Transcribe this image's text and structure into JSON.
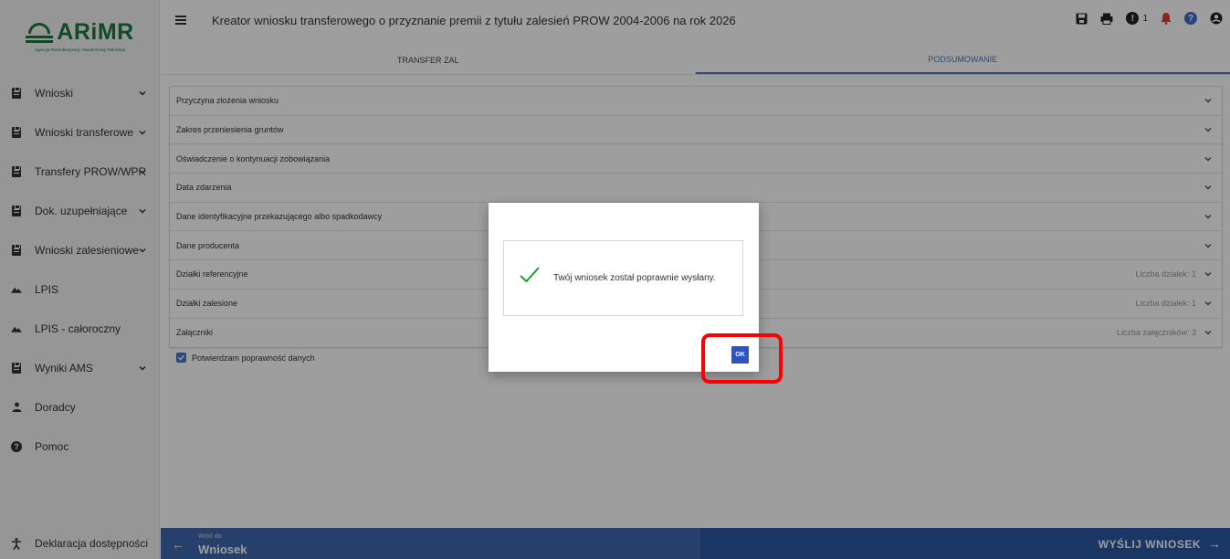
{
  "app": {
    "logo_text": "ARiMR",
    "logo_subtitle": "Agencja Restrukturyzacji i Modernizacji Rolnictwa"
  },
  "header": {
    "title": "Kreator wniosku transferowego o przyznanie premii z tytułu zalesień PROW 2004-2006 na rok 2026",
    "notification_count": "1"
  },
  "sidebar": {
    "items": [
      {
        "label": "Wnioski",
        "icon": "clipboard-icon",
        "expandable": true
      },
      {
        "label": "Wnioski transferowe",
        "icon": "clipboard-icon",
        "expandable": true
      },
      {
        "label": "Transfery PROW/WPR",
        "icon": "clipboard-icon",
        "expandable": true
      },
      {
        "label": "Dok. uzupełniające",
        "icon": "clipboard-icon",
        "expandable": true
      },
      {
        "label": "Wnioski zalesieniowe",
        "icon": "clipboard-icon",
        "expandable": true
      },
      {
        "label": "LPIS",
        "icon": "mountain-icon",
        "expandable": false
      },
      {
        "label": "LPIS - całoroczny",
        "icon": "mountain-icon",
        "expandable": false
      },
      {
        "label": "Wyniki AMS",
        "icon": "clipboard-icon",
        "expandable": true
      },
      {
        "label": "Doradcy",
        "icon": "person-icon",
        "expandable": false
      },
      {
        "label": "Pomoc",
        "icon": "help-icon",
        "expandable": false
      }
    ],
    "accessibility": "Deklaracja dostępności"
  },
  "tabs": [
    {
      "label": "TRANSFER ZAL",
      "active": false
    },
    {
      "label": "PODSUMOWANIE",
      "active": true
    }
  ],
  "sections": [
    {
      "label": "Przyczyna złożenia wniosku",
      "meta": ""
    },
    {
      "label": "Zakres przeniesienia gruntów",
      "meta": ""
    },
    {
      "label": "Oświadczenie o kontynuacji zobowiązania",
      "meta": ""
    },
    {
      "label": "Data zdarzenia",
      "meta": ""
    },
    {
      "label": "Dane identyfikacyjne przekazującego albo spadkodawcy",
      "meta": ""
    },
    {
      "label": "Dane producenta",
      "meta": ""
    },
    {
      "label": "Działki referencyjne",
      "meta": "Liczba działek: 1"
    },
    {
      "label": "Działki zalesione",
      "meta": "Liczba działek: 1"
    },
    {
      "label": "Załączniki",
      "meta": "Liczba załączników: 3"
    }
  ],
  "confirm": {
    "label": "Potwierdzam poprawność danych",
    "checked": true
  },
  "footer": {
    "back_small": "Wróć do",
    "back_big": "Wniosek",
    "send": "WYŚLIJ WNIOSEK"
  },
  "dialog": {
    "message": "Twój wniosek został poprawnie wysłany.",
    "ok": "OK"
  },
  "colors": {
    "brand_green": "#1a7a3c",
    "accent_blue": "#4a78c0",
    "footer_blue": "#2b57a3",
    "ok_blue": "#2d54c4",
    "highlight_red": "#ff0000",
    "check_green": "#1e9a2c"
  }
}
